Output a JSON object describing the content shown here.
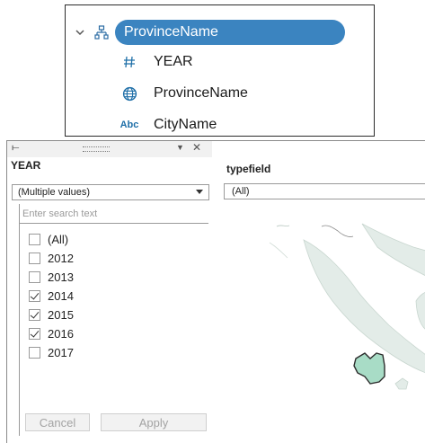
{
  "hierarchy": {
    "root_label": "ProvinceName",
    "children": [
      {
        "icon": "hash-icon",
        "label": "YEAR"
      },
      {
        "icon": "globe-icon",
        "label": "ProvinceName"
      },
      {
        "icon": "abc-icon",
        "label": "CityName",
        "icon_text": "Abc"
      }
    ]
  },
  "filter": {
    "title": "YEAR",
    "dropdown_value": "(Multiple values)",
    "search_placeholder": "Enter search text",
    "options": [
      {
        "label": "(All)",
        "checked": false
      },
      {
        "label": "2012",
        "checked": false
      },
      {
        "label": "2013",
        "checked": false
      },
      {
        "label": "2014",
        "checked": true
      },
      {
        "label": "2015",
        "checked": true
      },
      {
        "label": "2016",
        "checked": true
      },
      {
        "label": "2017",
        "checked": false
      }
    ],
    "cancel_label": "Cancel",
    "apply_label": "Apply"
  },
  "typefield": {
    "title": "typefield",
    "value": "(All)"
  },
  "colors": {
    "pill": "#3b84c0",
    "map_land": "#e3ece8",
    "map_highlight": "#a8dcc6"
  }
}
